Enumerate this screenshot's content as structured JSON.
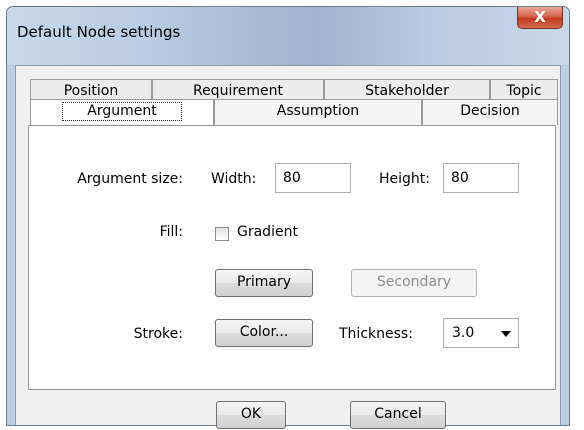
{
  "window": {
    "title": "Default Node settings",
    "close_glyph": "X"
  },
  "tabs_row1": [
    {
      "label": "Position"
    },
    {
      "label": "Requirement"
    },
    {
      "label": "Stakeholder"
    },
    {
      "label": "Topic"
    }
  ],
  "tabs_row2": [
    {
      "label": "Argument",
      "selected": true
    },
    {
      "label": "Assumption"
    },
    {
      "label": "Decision"
    }
  ],
  "form": {
    "size_label": "Argument size:",
    "width_label": "Width:",
    "width_value": "80",
    "height_label": "Height:",
    "height_value": "80",
    "fill_label": "Fill:",
    "gradient_label": "Gradient",
    "gradient_checked": false,
    "primary_label": "Primary",
    "secondary_label": "Secondary",
    "stroke_label": "Stroke:",
    "color_label": "Color...",
    "thickness_label": "Thickness:",
    "thickness_value": "3.0"
  },
  "footer": {
    "ok_label": "OK",
    "cancel_label": "Cancel"
  },
  "colors": {
    "frame": "#b9cde5",
    "close_button": "#c7472c",
    "client_bg": "#f0f0f0"
  }
}
